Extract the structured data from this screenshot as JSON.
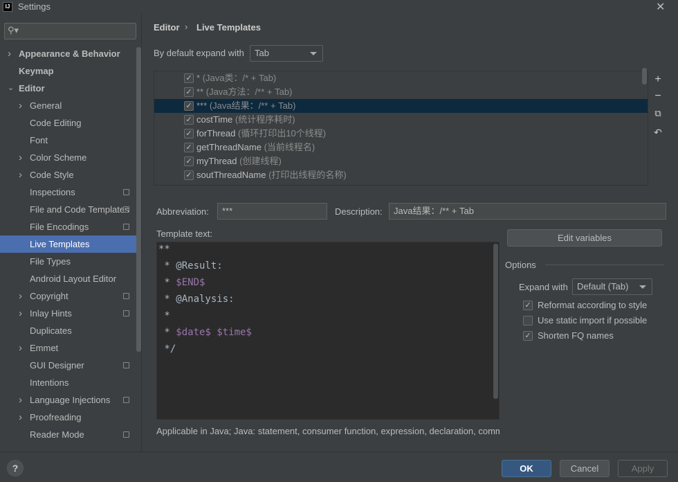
{
  "window": {
    "title": "Settings",
    "app_icon_text": "IJ"
  },
  "search": {
    "placeholder": "",
    "icon": "search-icon"
  },
  "sidebar": {
    "items": [
      {
        "label": "Appearance & Behavior",
        "level": 0,
        "chevron": "right",
        "bold": true
      },
      {
        "label": "Keymap",
        "level": 0,
        "bold": true
      },
      {
        "label": "Editor",
        "level": 0,
        "chevron": "down",
        "bold": true
      },
      {
        "label": "General",
        "level": 1,
        "chevron": "right"
      },
      {
        "label": "Code Editing",
        "level": 1
      },
      {
        "label": "Font",
        "level": 1
      },
      {
        "label": "Color Scheme",
        "level": 1,
        "chevron": "right"
      },
      {
        "label": "Code Style",
        "level": 1,
        "chevron": "right"
      },
      {
        "label": "Inspections",
        "level": 1,
        "project": true
      },
      {
        "label": "File and Code Templates",
        "level": 1,
        "project": true
      },
      {
        "label": "File Encodings",
        "level": 1,
        "project": true
      },
      {
        "label": "Live Templates",
        "level": 1,
        "selected": true
      },
      {
        "label": "File Types",
        "level": 1
      },
      {
        "label": "Android Layout Editor",
        "level": 1
      },
      {
        "label": "Copyright",
        "level": 1,
        "chevron": "right",
        "project": true
      },
      {
        "label": "Inlay Hints",
        "level": 1,
        "chevron": "right",
        "project": true
      },
      {
        "label": "Duplicates",
        "level": 1
      },
      {
        "label": "Emmet",
        "level": 1,
        "chevron": "right"
      },
      {
        "label": "GUI Designer",
        "level": 1,
        "project": true
      },
      {
        "label": "Intentions",
        "level": 1
      },
      {
        "label": "Language Injections",
        "level": 1,
        "chevron": "right",
        "project": true
      },
      {
        "label": "Proofreading",
        "level": 1,
        "chevron": "right"
      },
      {
        "label": "Reader Mode",
        "level": 1,
        "project": true
      }
    ]
  },
  "breadcrumb": {
    "parent": "Editor",
    "separator": "›",
    "current": "Live Templates"
  },
  "expand_default": {
    "label": "By default expand with",
    "value": "Tab"
  },
  "templates": [
    {
      "name": "*",
      "desc": "(Java类：/* + Tab)",
      "checked": true,
      "dim": true
    },
    {
      "name": "**",
      "desc": "(Java方法：/** + Tab)",
      "checked": true,
      "dim": true
    },
    {
      "name": "***",
      "desc": "(Java结果：/** + Tab)",
      "checked": true,
      "selected": true,
      "dim": true
    },
    {
      "name": "costTime",
      "desc": "(统计程序耗时)",
      "checked": true
    },
    {
      "name": "forThread",
      "desc": "(循环打印出10个线程)",
      "checked": true
    },
    {
      "name": "getThreadName",
      "desc": "(当前线程名)",
      "checked": true
    },
    {
      "name": "myThread",
      "desc": "(创建线程)",
      "checked": true
    },
    {
      "name": "soutThreadName",
      "desc": "(打印出线程的名称)",
      "checked": true
    }
  ],
  "toolbar": [
    "add-icon",
    "remove-icon",
    "copy-icon",
    "restore-icon"
  ],
  "abbreviation": {
    "label": "Abbreviation:",
    "value": "***"
  },
  "description": {
    "label": "Description:",
    "value": "Java结果：/** + Tab"
  },
  "template_text": {
    "label": "Template text:",
    "lines": [
      [
        {
          "t": "**"
        }
      ],
      [
        {
          "t": " * @Result:"
        }
      ],
      [
        {
          "t": " * "
        },
        {
          "t": "$END$",
          "v": true
        }
      ],
      [
        {
          "t": " * @Analysis:"
        }
      ],
      [
        {
          "t": " *"
        }
      ],
      [
        {
          "t": " * "
        },
        {
          "t": "$date$ $time$",
          "v": true
        }
      ],
      [
        {
          "t": " */"
        }
      ]
    ]
  },
  "edit_variables": "Edit variables",
  "options": {
    "title": "Options",
    "expand_label": "Expand with",
    "expand_value": "Default (Tab)",
    "checks": [
      {
        "label": "Reformat according to style",
        "checked": true
      },
      {
        "label": "Use static import if possible",
        "checked": false
      },
      {
        "label": "Shorten FQ names",
        "checked": true
      }
    ]
  },
  "applicable": "Applicable in Java; Java: statement, consumer function, expression, declaration, comm",
  "buttons": {
    "ok": "OK",
    "cancel": "Cancel",
    "apply": "Apply",
    "help": "?"
  },
  "colors": {
    "selection": "#4b6eaf",
    "row_selection": "#0d293e",
    "ok": "#365880",
    "template_var": "#9876aa"
  }
}
